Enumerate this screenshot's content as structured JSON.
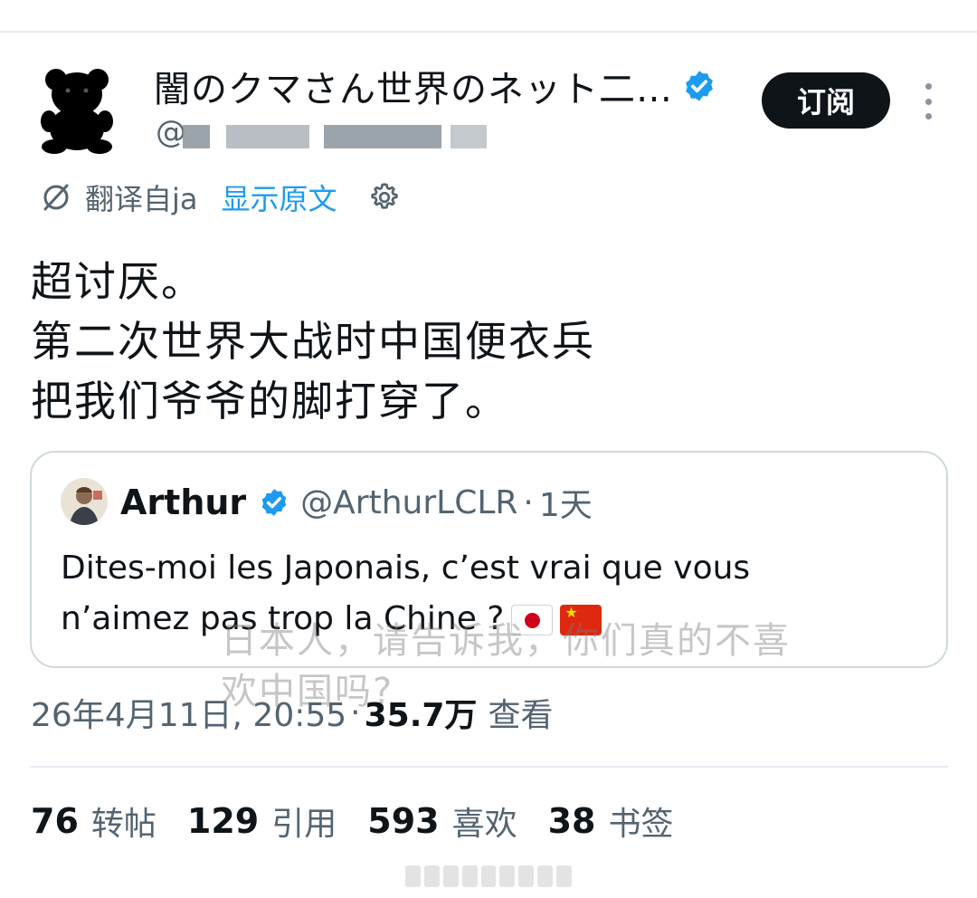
{
  "header": {
    "display_name": "闇のクマさん世界のネット二…",
    "handle": "@",
    "subscribe_label": "订阅"
  },
  "translation": {
    "translated_from": "翻译自ja",
    "show_original": "显示原文"
  },
  "tweet": {
    "lines": [
      "超讨厌。",
      "第二次世界大战时中国便衣兵",
      "把我们爷爷的脚打穿了。"
    ]
  },
  "quote": {
    "name": "Arthur",
    "handle": "@ArthurLCLR",
    "separator": "·",
    "time": "1天",
    "text_line1": "Dites-moi les Japonais, c’est vrai que vous",
    "text_line2": "n’aimez pas trop la Chine ?"
  },
  "watermark": {
    "line1": "日本人，请告诉我，你们真的不喜",
    "line2": "欢中国吗?"
  },
  "meta": {
    "timestamp": "26年4月11日, 20:55",
    "separator": "·",
    "views": "35.7万",
    "views_label": "查看"
  },
  "stats": [
    {
      "num": "76",
      "label": "转帖"
    },
    {
      "num": "129",
      "label": "引用"
    },
    {
      "num": "593",
      "label": "喜欢"
    },
    {
      "num": "38",
      "label": "书签"
    }
  ],
  "colors": {
    "accent": "#1d9bf0",
    "text_primary": "#0f1419",
    "text_secondary": "#536471",
    "border": "#cfd9de"
  },
  "icons": {
    "verified": "verified-badge-icon",
    "translate": "translate-icon",
    "settings": "gear-icon",
    "more": "more-vertical-icon"
  }
}
